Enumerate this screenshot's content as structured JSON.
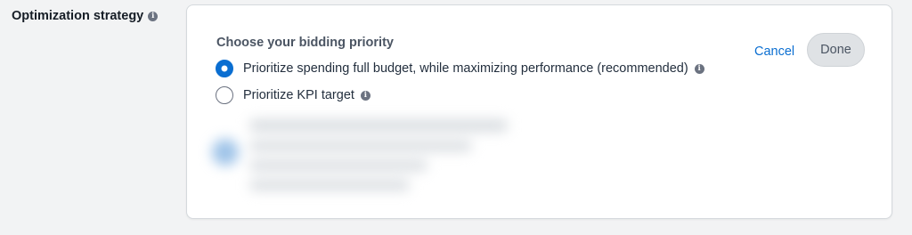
{
  "section": {
    "label": "Optimization strategy",
    "info_icon": "info-icon"
  },
  "panel": {
    "heading": "Choose your bidding priority",
    "options": [
      {
        "label": "Prioritize spending full budget, while maximizing performance (recommended)",
        "selected": true,
        "info_icon": "info-icon"
      },
      {
        "label": "Prioritize KPI target",
        "selected": false,
        "info_icon": "info-icon"
      }
    ],
    "cancel_label": "Cancel",
    "done_label": "Done"
  },
  "colors": {
    "accent": "#0a6ed1",
    "page_background": "#f2f3f4",
    "panel_background": "#ffffff"
  }
}
